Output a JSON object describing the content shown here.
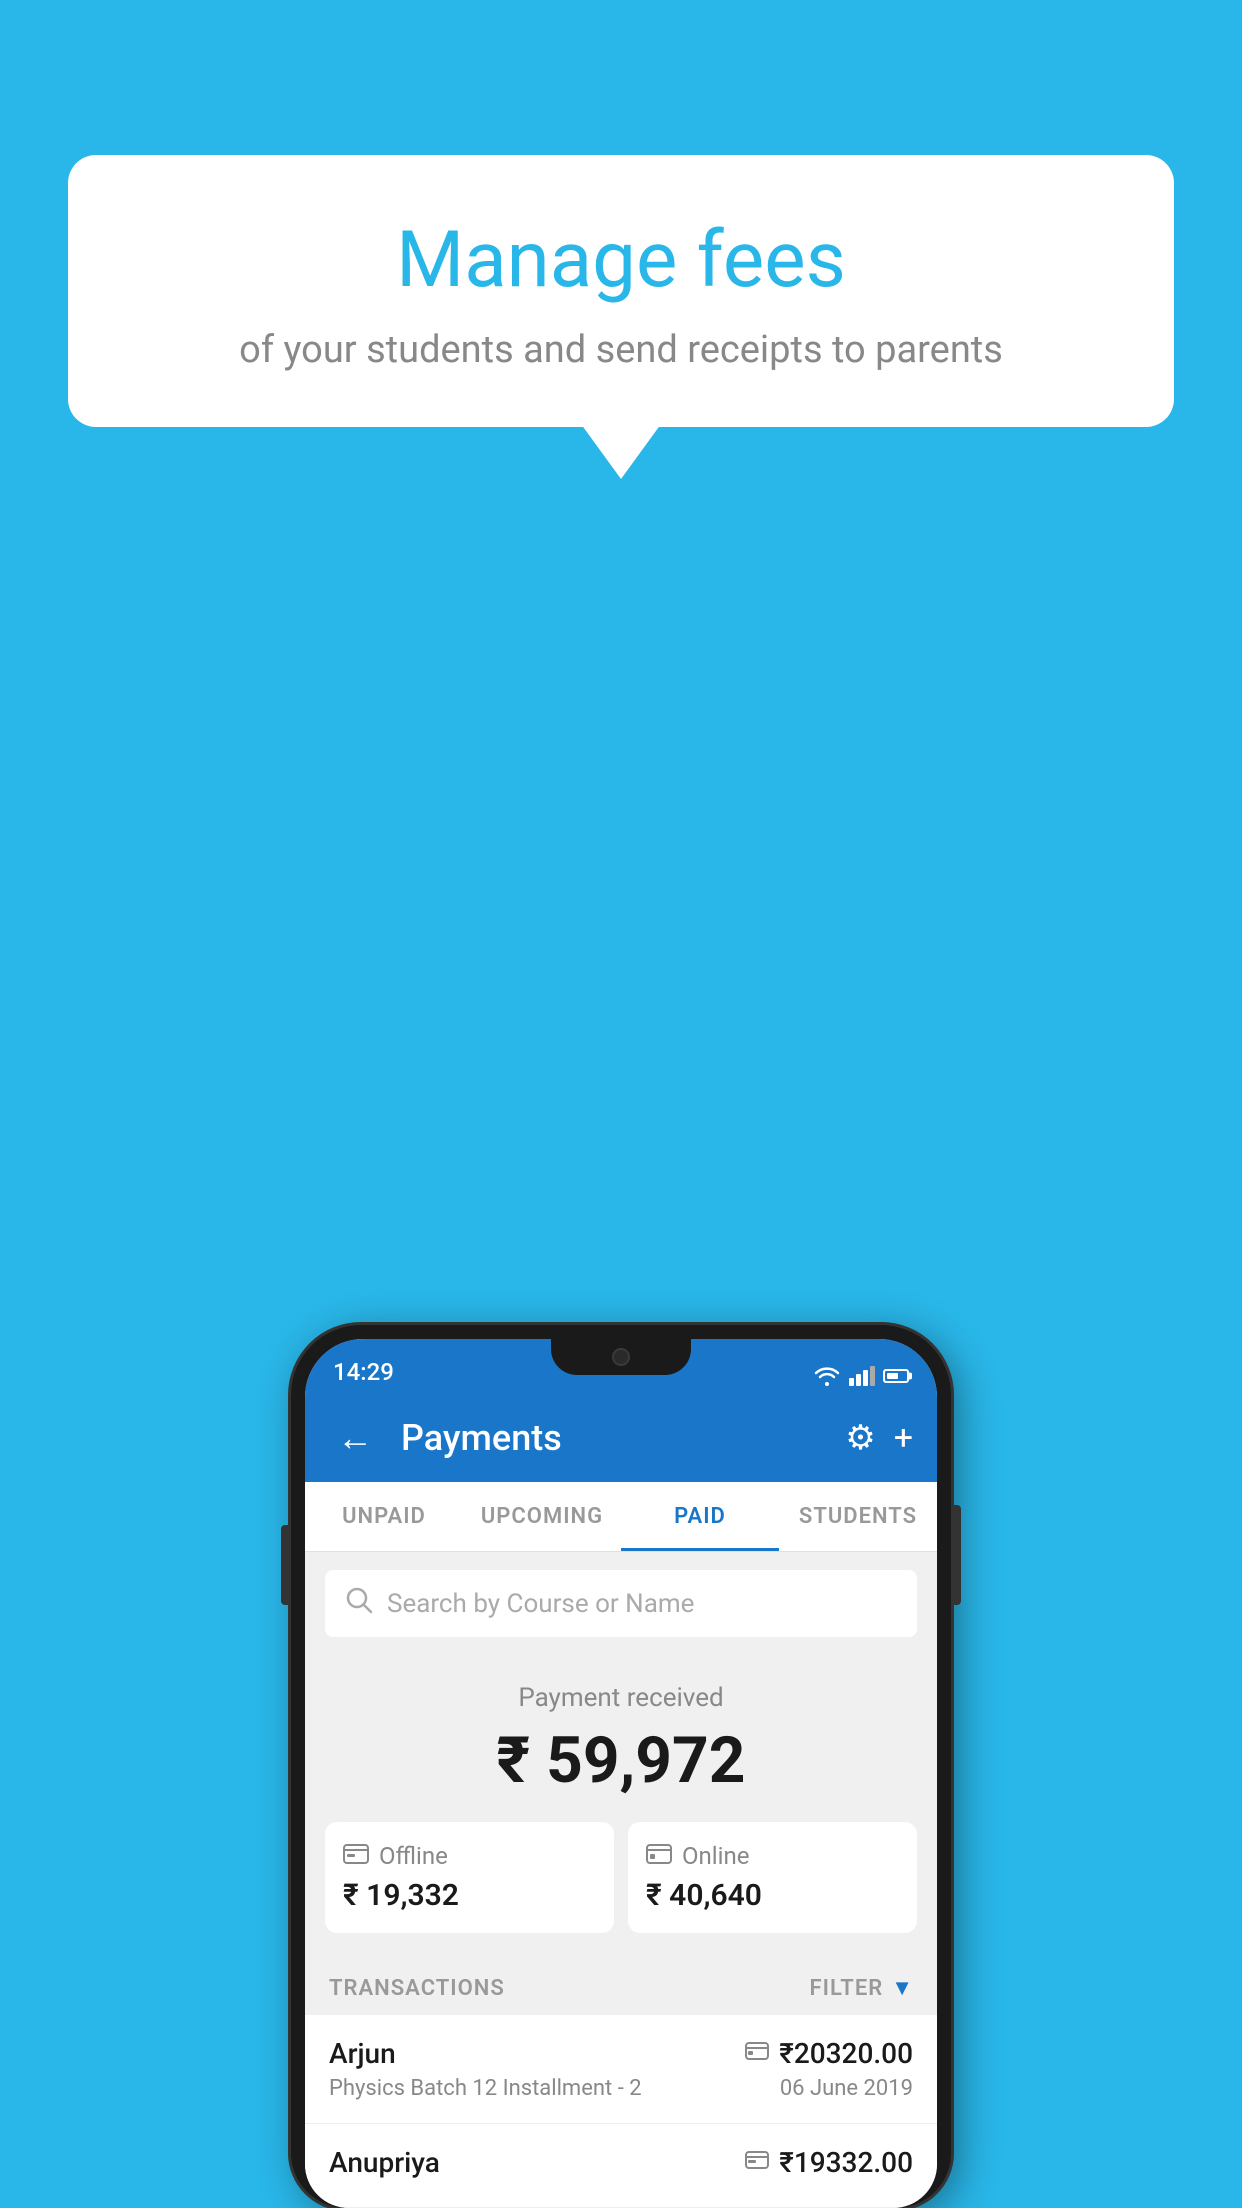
{
  "background_color": "#29B6E8",
  "speech_bubble": {
    "title": "Manage fees",
    "subtitle": "of your students and send receipts to parents"
  },
  "status_bar": {
    "time": "14:29"
  },
  "app_bar": {
    "title": "Payments",
    "back_label": "←",
    "gear_label": "⚙",
    "plus_label": "+"
  },
  "tabs": [
    {
      "label": "UNPAID",
      "active": false
    },
    {
      "label": "UPCOMING",
      "active": false
    },
    {
      "label": "PAID",
      "active": true
    },
    {
      "label": "STUDENTS",
      "active": false
    }
  ],
  "search": {
    "placeholder": "Search by Course or Name"
  },
  "payment_summary": {
    "label": "Payment received",
    "amount": "₹ 59,972",
    "offline": {
      "type": "Offline",
      "amount": "₹ 19,332"
    },
    "online": {
      "type": "Online",
      "amount": "₹ 40,640"
    }
  },
  "transactions": {
    "header_label": "TRANSACTIONS",
    "filter_label": "FILTER",
    "rows": [
      {
        "name": "Arjun",
        "course": "Physics Batch 12 Installment - 2",
        "amount": "₹20320.00",
        "date": "06 June 2019",
        "payment_type": "online"
      },
      {
        "name": "Anupriya",
        "course": "",
        "amount": "₹19332.00",
        "date": "",
        "payment_type": "offline"
      }
    ]
  }
}
